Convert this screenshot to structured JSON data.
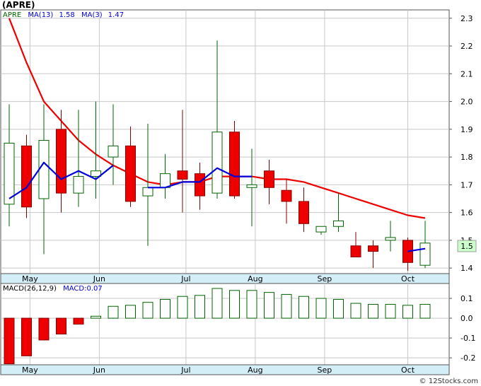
{
  "ticker": "(APRE)",
  "watermark": "© 12Stocks.com",
  "colors": {
    "up_fill": "#ffffff",
    "up_stroke": "#006600",
    "down_fill": "#ee0000",
    "down_stroke": "#880000",
    "wick": "#006600",
    "ma13": "#ee0000",
    "ma3": "#0000dd",
    "axis_bg": "#d4eef8",
    "grid": "#c8c8c8",
    "last_price_bg": "#ccffcc",
    "macd_bar_stroke": "#006600",
    "macd_neg_fill": "#ee0000"
  },
  "price_legend": {
    "symbol": "APRE",
    "ma13_label": "MA(13)",
    "ma13_value": "1.58",
    "ma3_label": "MA(3)",
    "ma3_value": "1.47"
  },
  "macd_legend": {
    "label": "MACD(26,12,9)",
    "value_label": "MACD:0.07"
  },
  "last_price_label": "1.5",
  "chart_data": [
    {
      "type": "candlestick",
      "title": "(APRE)",
      "x_tick_labels": [
        "May",
        "Jun",
        "Jul",
        "Aug",
        "Sep",
        "Oct"
      ],
      "x_tick_week_index": [
        1.2,
        5.2,
        10.2,
        14.2,
        18.2,
        23
      ],
      "y_tick_labels": [
        "1.4",
        "1.5",
        "1.6",
        "1.7",
        "1.8",
        "1.9",
        "2.0",
        "2.1",
        "2.2",
        "2.3"
      ],
      "ylim": [
        1.38,
        2.33
      ],
      "grid": true,
      "weeks": [
        {
          "open": 1.63,
          "high": 1.99,
          "low": 1.55,
          "close": 1.85
        },
        {
          "open": 1.84,
          "high": 1.88,
          "low": 1.58,
          "close": 1.62
        },
        {
          "open": 1.65,
          "high": 1.99,
          "low": 1.45,
          "close": 1.86
        },
        {
          "open": 1.9,
          "high": 1.97,
          "low": 1.6,
          "close": 1.67
        },
        {
          "open": 1.67,
          "high": 1.97,
          "low": 1.62,
          "close": 1.73
        },
        {
          "open": 1.73,
          "high": 2.0,
          "low": 1.65,
          "close": 1.75
        },
        {
          "open": 1.8,
          "high": 1.99,
          "low": 1.7,
          "close": 1.84
        },
        {
          "open": 1.84,
          "high": 1.91,
          "low": 1.62,
          "close": 1.64
        },
        {
          "open": 1.66,
          "high": 1.92,
          "low": 1.48,
          "close": 1.69
        },
        {
          "open": 1.69,
          "high": 1.81,
          "low": 1.65,
          "close": 1.74
        },
        {
          "open": 1.75,
          "high": 1.97,
          "low": 1.6,
          "close": 1.72
        },
        {
          "open": 1.74,
          "high": 1.78,
          "low": 1.61,
          "close": 1.66
        },
        {
          "open": 1.67,
          "high": 2.22,
          "low": 1.65,
          "close": 1.89
        },
        {
          "open": 1.89,
          "high": 1.93,
          "low": 1.65,
          "close": 1.66
        },
        {
          "open": 1.69,
          "high": 1.83,
          "low": 1.55,
          "close": 1.7
        },
        {
          "open": 1.75,
          "high": 1.79,
          "low": 1.63,
          "close": 1.69
        },
        {
          "open": 1.68,
          "high": 1.72,
          "low": 1.56,
          "close": 1.64
        },
        {
          "open": 1.64,
          "high": 1.69,
          "low": 1.53,
          "close": 1.56
        },
        {
          "open": 1.53,
          "high": 1.55,
          "low": 1.52,
          "close": 1.55
        },
        {
          "open": 1.55,
          "high": 1.67,
          "low": 1.53,
          "close": 1.57
        },
        {
          "open": 1.48,
          "high": 1.53,
          "low": 1.44,
          "close": 1.44
        },
        {
          "open": 1.48,
          "high": 1.5,
          "low": 1.4,
          "close": 1.46
        },
        {
          "open": 1.5,
          "high": 1.57,
          "low": 1.46,
          "close": 1.51
        },
        {
          "open": 1.5,
          "high": 1.51,
          "low": 1.39,
          "close": 1.42
        },
        {
          "open": 1.41,
          "high": 1.57,
          "low": 1.4,
          "close": 1.49
        }
      ],
      "series": [
        {
          "name": "MA(13)",
          "values": [
            2.3,
            2.14,
            2.0,
            1.93,
            1.86,
            1.81,
            1.77,
            1.74,
            1.71,
            1.7,
            1.71,
            1.71,
            1.73,
            1.73,
            1.73,
            1.72,
            1.72,
            1.71,
            1.69,
            1.67,
            1.65,
            1.63,
            1.61,
            1.59,
            1.58
          ]
        },
        {
          "name": "MA(3)",
          "values": [
            1.65,
            1.69,
            1.78,
            1.72,
            1.75,
            1.72,
            1.77,
            null,
            1.69,
            1.69,
            1.71,
            1.71,
            1.76,
            1.73,
            1.73,
            null,
            null,
            null,
            null,
            null,
            null,
            null,
            null,
            1.46,
            1.47
          ]
        }
      ]
    },
    {
      "type": "bar",
      "title": "MACD(26,12,9)",
      "y_tick_labels": [
        "0.1",
        "0.0",
        "-0.1",
        "-0.2"
      ],
      "ylim": [
        -0.235,
        0.175
      ],
      "grid": true,
      "x_tick_labels": [
        "May",
        "Jun",
        "Jul",
        "Aug",
        "Sep",
        "Oct"
      ],
      "series": [
        {
          "name": "MACD",
          "values": [
            -0.23,
            -0.19,
            -0.11,
            -0.08,
            -0.03,
            0.01,
            0.06,
            0.065,
            0.08,
            0.095,
            0.11,
            0.115,
            0.15,
            0.14,
            0.14,
            0.13,
            0.12,
            0.11,
            0.1,
            0.095,
            0.075,
            0.07,
            0.07,
            0.065,
            0.07
          ]
        }
      ]
    }
  ]
}
